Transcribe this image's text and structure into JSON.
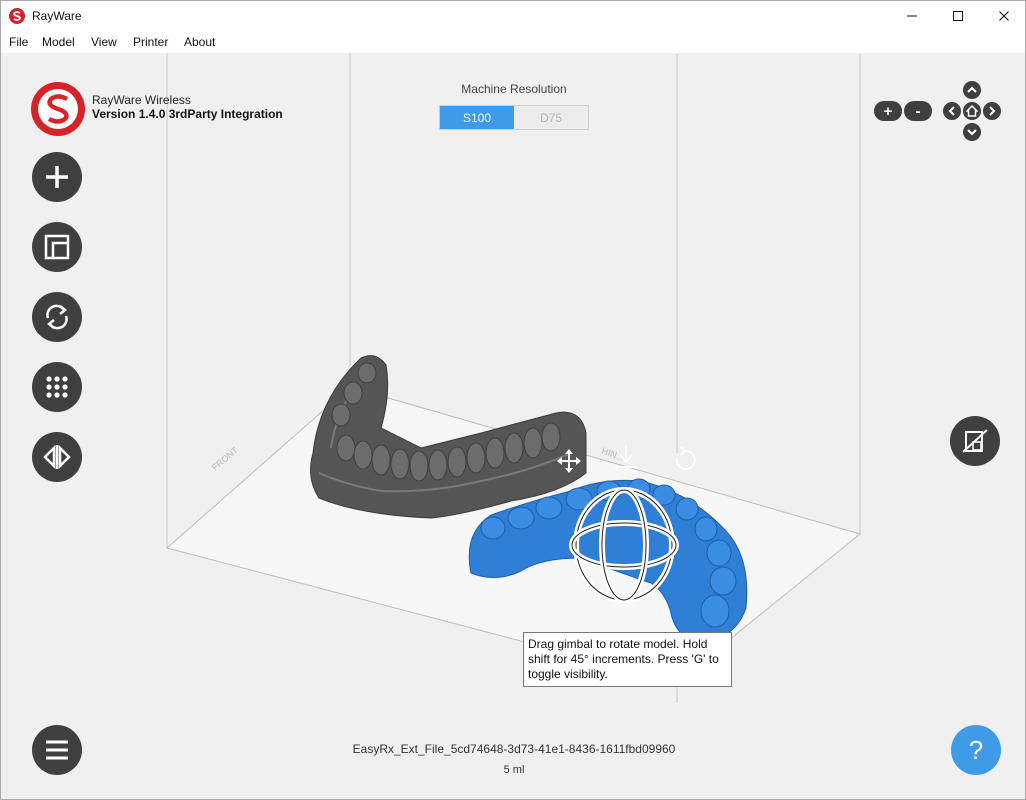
{
  "window": {
    "title": "RayWare",
    "icons": {
      "app": "rayware-logo-icon",
      "minimize": "minimize-icon",
      "maximize": "maximize-icon",
      "close": "close-icon"
    }
  },
  "menu": {
    "items": [
      "File",
      "Model",
      "View",
      "Printer",
      "About"
    ]
  },
  "brand": {
    "name": "RayWare Wireless",
    "version": "Version 1.4.0 3rdParty Integration"
  },
  "sidebar": {
    "buttons": [
      {
        "name": "add-model",
        "icon": "plus-icon"
      },
      {
        "name": "layout",
        "icon": "layout-icon"
      },
      {
        "name": "orient",
        "icon": "rotate-arrows-icon"
      },
      {
        "name": "supports",
        "icon": "grid-dots-icon"
      },
      {
        "name": "mirror",
        "icon": "mirror-icon"
      }
    ]
  },
  "resolution": {
    "label": "Machine Resolution",
    "options": [
      "S100",
      "D75"
    ],
    "selected": "S100"
  },
  "view_controls": {
    "zoom_in": "+",
    "zoom_out": "-"
  },
  "gizmo_labels": {
    "front": "FRONT",
    "hinge": "HIN..."
  },
  "tooltip": {
    "text": "Drag gimbal to rotate model. Hold shift for 45° increments. Press 'G' to toggle visibility."
  },
  "footer": {
    "file_name": "EasyRx_Ext_File_5cd74648-3d73-41e1-8436-1611fbd09960",
    "volume": "5 ml",
    "help": "?"
  },
  "colors": {
    "accent": "#3f9be8",
    "brand_red": "#d6232a",
    "button_dark": "#3f3f3f",
    "model_gray": "#5a5a5a",
    "model_blue": "#2f7fd6"
  }
}
